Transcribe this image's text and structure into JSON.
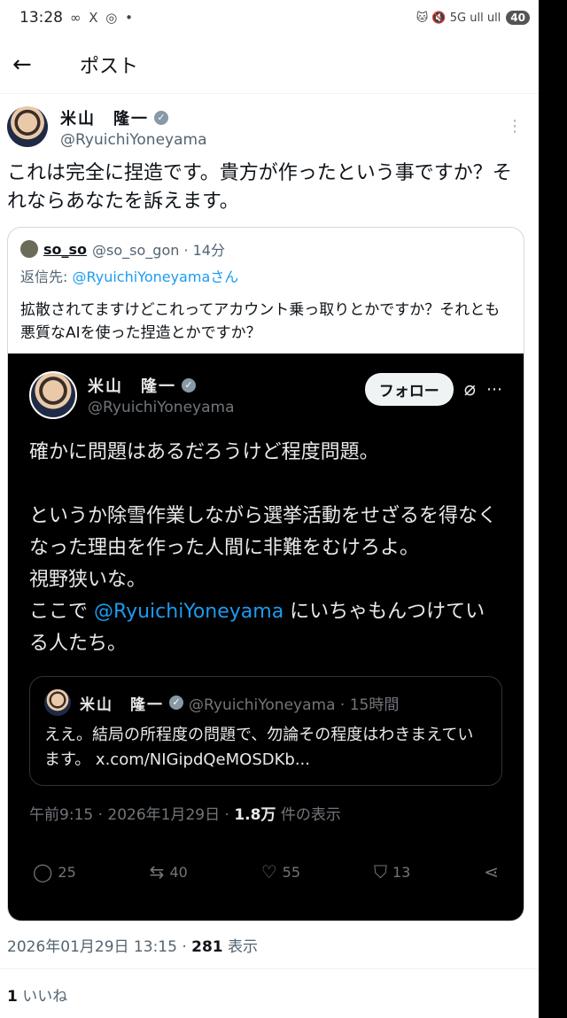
{
  "status": {
    "time": "13:28",
    "icons": "∞ X ◎ •",
    "right": "🐱 🔇 5G ull ull",
    "battery": "40"
  },
  "header": {
    "back": "←",
    "title": "ポスト"
  },
  "post": {
    "name": "米山　隆一",
    "handle": "@RyuichiYoneyama",
    "text": "これは完全に捏造です。貴方が作ったという事ですか？それならあなたを訴えます。",
    "quote": {
      "name": "so_so",
      "meta": "@so_so_gon · 14分",
      "reply_prefix": "返信先: ",
      "reply_mention": "@RyuichiYoneyamaさん",
      "text": "拡散されてますけどこれってアカウント乗っ取りとかですか？それとも悪質なAIを使った捏造とかですか？",
      "embedded": {
        "name": "米山　隆一",
        "handle": "@RyuichiYoneyama",
        "follow": "フォロー",
        "text1": "確かに問題はあるだろうけど程度問題。\n\nというか除雪作業しながら選挙活動をせざるを得なくなった理由を作った人間に非難をむけろよ。\n視野狭いな。\nここで ",
        "mention": "@RyuichiYoneyama",
        "text2": " にいちゃもんつけている人たち。",
        "inner": {
          "name": "米山　隆一",
          "meta": "@RyuichiYoneyama · 15時間",
          "text": "ええ。結局の所程度の問題で、勿論その程度はわきまえています。 x.com/NIGipdQeMOSDKb..."
        },
        "stamp": "午前9:15 · 2026年1月29日 · ",
        "views_count": "1.8万",
        "views_label": " 件の表示",
        "stats": {
          "replies": "25",
          "reposts": "40",
          "likes": "55",
          "bookmarks": "13"
        }
      }
    },
    "timestamp": "2026年01月29日 13:15 · ",
    "views": "281",
    "views_label": " 表示",
    "likes_count": "1",
    "likes_label": " いいね"
  }
}
